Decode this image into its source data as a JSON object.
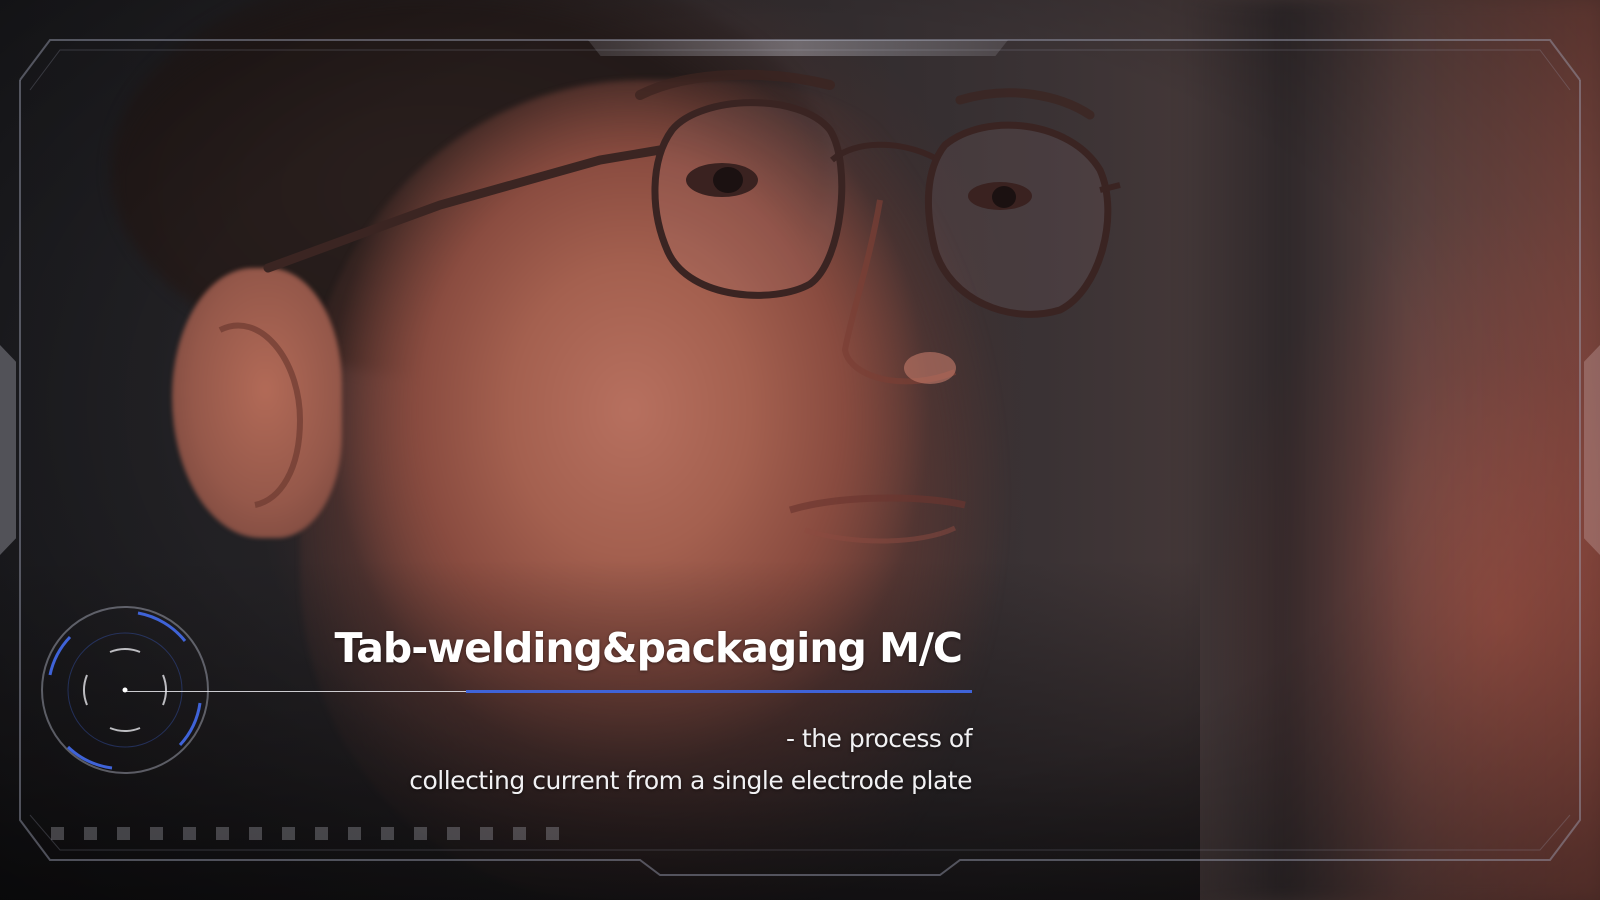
{
  "caption": {
    "title": "Tab-welding&packaging M/C",
    "subtitle_line1": "- the process of",
    "subtitle_line2": "collecting current from a single electrode plate"
  },
  "colors": {
    "accent_blue": "#3f63d8",
    "text": "#ffffff",
    "hud_line": "#9aa0b8"
  },
  "hud": {
    "progress_squares": 16,
    "reticle_icon": "target-reticle-icon"
  },
  "scene": {
    "subject": "man with round glasses"
  }
}
